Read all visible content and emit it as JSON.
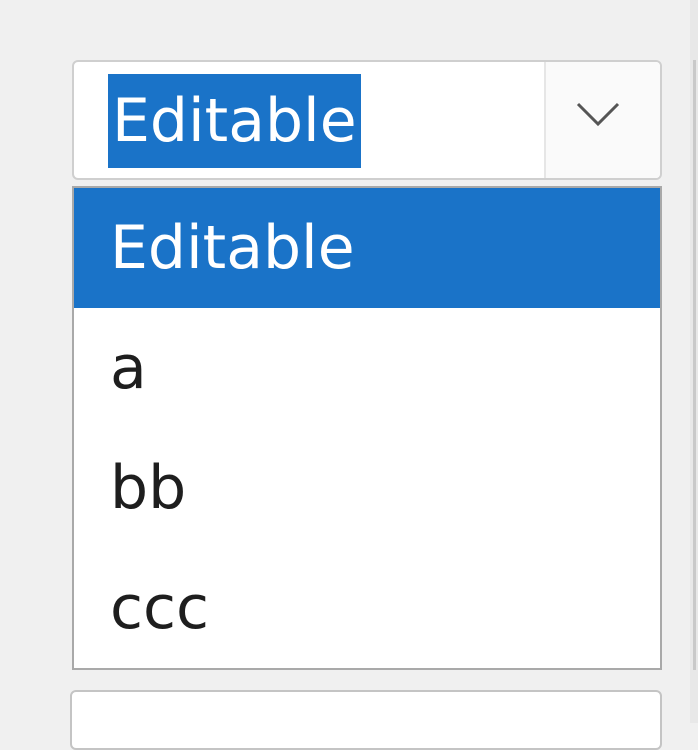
{
  "combo_box": {
    "value": "Editable",
    "selected_text_highlighted": true,
    "dropdown_icon": "chevron-down-icon",
    "expanded": true
  },
  "dropdown": {
    "selected_index": 0,
    "items": [
      {
        "label": "Editable"
      },
      {
        "label": "a"
      },
      {
        "label": "bb"
      },
      {
        "label": "ccc"
      }
    ]
  },
  "colors": {
    "selection": "#1a73c8",
    "background": "#f0f0f0",
    "text": "#1e1e1e"
  }
}
